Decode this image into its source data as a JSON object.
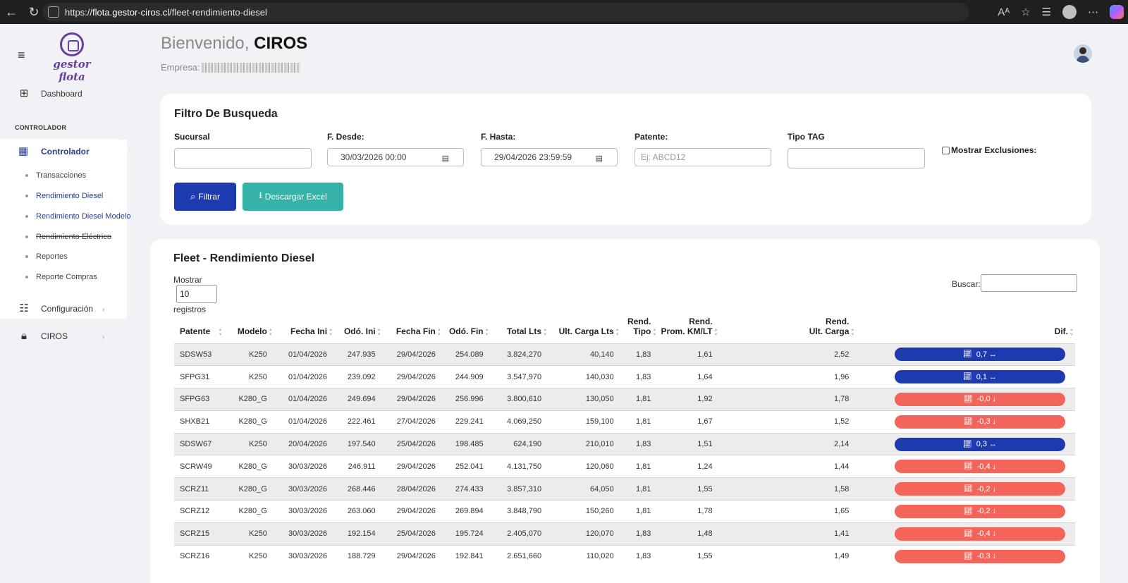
{
  "browser": {
    "url_prefix": "https://",
    "url_host": "flota.gestor-ciros.cl",
    "url_path": "/fleet-rendimiento-diesel"
  },
  "sidebar": {
    "logo_text": "gestor flota",
    "dashboard": "Dashboard",
    "section": "CONTROLADOR",
    "active": "Controlador",
    "sub_items": [
      {
        "label": "Transacciones"
      },
      {
        "label": "Rendimiento Diesel"
      },
      {
        "label": "Rendimiento Diesel Modelo"
      },
      {
        "label": "Rendimiento Eléctrico"
      },
      {
        "label": "Reportes"
      },
      {
        "label": "Reporte Compras"
      }
    ],
    "config": "Configuración",
    "ciros": "CIROS"
  },
  "header": {
    "welcome": "Bienvenido,",
    "user": "CIROS",
    "empresa_label": "Empresa:"
  },
  "filter": {
    "title": "Filtro De Busqueda",
    "sucursal_label": "Sucursal",
    "desde_label": "F. Desde:",
    "desde_value": "30/03/2026 00:00",
    "hasta_label": "F. Hasta:",
    "hasta_value": "29/04/2026 23:59:59",
    "patente_label": "Patente:",
    "patente_placeholder": "Ej: ABCD12",
    "tag_label": "Tipo TAG",
    "exclusion_label": "Mostrar Exclusiones:",
    "btn_filter": "Filtrar",
    "btn_excel": "Descargar Excel"
  },
  "table": {
    "title": "Fleet - Rendimiento Diesel",
    "show_label": "Mostrar",
    "show_value": "10",
    "records_label": "registros",
    "search_label": "Buscar:",
    "headers": {
      "patente": "Patente",
      "modelo": "Modelo",
      "fecha_ini": "Fecha Ini",
      "odo_ini": "Odó. Ini",
      "fecha_fin": "Fecha Fin",
      "odo_fin": "Odó. Fin",
      "total_lts": "Total Lts",
      "ult_carga_lts": "Ult. Carga Lts",
      "rend_tipo_1": "Rend.",
      "rend_tipo_2": "Tipo",
      "rend_prom_1": "Rend.",
      "rend_prom_2": "Prom. KM/LT",
      "rend_ult_1": "Rend.",
      "rend_ult_2": "Ult. Carga",
      "dif": "Dif."
    },
    "colors": {
      "up": "#1e3ab0",
      "down": "#f5645a"
    },
    "rows": [
      {
        "patente": "SDSW53",
        "modelo": "K250",
        "fecha_ini": "01/04/2026",
        "odo_ini": "247.935",
        "fecha_fin": "29/04/2026",
        "odo_fin": "254.089",
        "total_lts": "3.824,270",
        "ult_carga": "40,140",
        "rend_tipo": "1,83",
        "rend_prom": "1,61",
        "rend_ult": "2,52",
        "dif": "0,7",
        "trend": "up"
      },
      {
        "patente": "SFPG31",
        "modelo": "K250",
        "fecha_ini": "01/04/2026",
        "odo_ini": "239.092",
        "fecha_fin": "29/04/2026",
        "odo_fin": "244.909",
        "total_lts": "3.547,970",
        "ult_carga": "140,030",
        "rend_tipo": "1,83",
        "rend_prom": "1,64",
        "rend_ult": "1,96",
        "dif": "0,1",
        "trend": "up"
      },
      {
        "patente": "SFPG63",
        "modelo": "K280_G",
        "fecha_ini": "01/04/2026",
        "odo_ini": "249.694",
        "fecha_fin": "29/04/2026",
        "odo_fin": "256.996",
        "total_lts": "3.800,610",
        "ult_carga": "130,050",
        "rend_tipo": "1,81",
        "rend_prom": "1,92",
        "rend_ult": "1,78",
        "dif": "-0,0",
        "trend": "down"
      },
      {
        "patente": "SHXB21",
        "modelo": "K280_G",
        "fecha_ini": "01/04/2026",
        "odo_ini": "222.461",
        "fecha_fin": "27/04/2026",
        "odo_fin": "229.241",
        "total_lts": "4.069,250",
        "ult_carga": "159,100",
        "rend_tipo": "1,81",
        "rend_prom": "1,67",
        "rend_ult": "1,52",
        "dif": "-0,3",
        "trend": "down"
      },
      {
        "patente": "SDSW67",
        "modelo": "K250",
        "fecha_ini": "20/04/2026",
        "odo_ini": "197.540",
        "fecha_fin": "25/04/2026",
        "odo_fin": "198.485",
        "total_lts": "624,190",
        "ult_carga": "210,010",
        "rend_tipo": "1,83",
        "rend_prom": "1,51",
        "rend_ult": "2,14",
        "dif": "0,3",
        "trend": "up"
      },
      {
        "patente": "SCRW49",
        "modelo": "K280_G",
        "fecha_ini": "30/03/2026",
        "odo_ini": "246.911",
        "fecha_fin": "29/04/2026",
        "odo_fin": "252.041",
        "total_lts": "4.131,750",
        "ult_carga": "120,060",
        "rend_tipo": "1,81",
        "rend_prom": "1,24",
        "rend_ult": "1,44",
        "dif": "-0,4",
        "trend": "down"
      },
      {
        "patente": "SCRZ11",
        "modelo": "K280_G",
        "fecha_ini": "30/03/2026",
        "odo_ini": "268.446",
        "fecha_fin": "28/04/2026",
        "odo_fin": "274.433",
        "total_lts": "3.857,310",
        "ult_carga": "64,050",
        "rend_tipo": "1,81",
        "rend_prom": "1,55",
        "rend_ult": "1,58",
        "dif": "-0,2",
        "trend": "down"
      },
      {
        "patente": "SCRZ12",
        "modelo": "K280_G",
        "fecha_ini": "30/03/2026",
        "odo_ini": "263.060",
        "fecha_fin": "29/04/2026",
        "odo_fin": "269.894",
        "total_lts": "3.848,790",
        "ult_carga": "150,260",
        "rend_tipo": "1,81",
        "rend_prom": "1,78",
        "rend_ult": "1,65",
        "dif": "-0,2",
        "trend": "down"
      },
      {
        "patente": "SCRZ15",
        "modelo": "K250",
        "fecha_ini": "30/03/2026",
        "odo_ini": "192.154",
        "fecha_fin": "25/04/2026",
        "odo_fin": "195.724",
        "total_lts": "2.405,070",
        "ult_carga": "120,070",
        "rend_tipo": "1,83",
        "rend_prom": "1,48",
        "rend_ult": "1,41",
        "dif": "-0,4",
        "trend": "down"
      },
      {
        "patente": "SCRZ16",
        "modelo": "K250",
        "fecha_ini": "30/03/2026",
        "odo_ini": "188.729",
        "fecha_fin": "29/04/2026",
        "odo_fin": "192.841",
        "total_lts": "2.651,660",
        "ult_carga": "110,020",
        "rend_tipo": "1,83",
        "rend_prom": "1,55",
        "rend_ult": "1,49",
        "dif": "-0,3",
        "trend": "down"
      }
    ]
  }
}
